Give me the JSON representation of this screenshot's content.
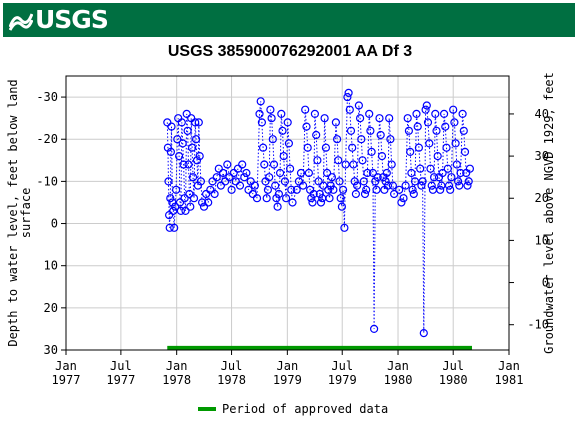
{
  "header": {
    "brand": "USGS",
    "title": "USGS 385900076292001 AA Df   3"
  },
  "colors": {
    "banner": "#006f41",
    "series": "#0000ff",
    "approved": "#009900"
  },
  "chart_data": {
    "type": "scatter",
    "title": "USGS 385900076292001 AA Df   3",
    "y_left_label": [
      "Depth to water level, feet below land",
      "surface"
    ],
    "y_right_label": "Groundwater level above NGVD 1929, feet",
    "y_left_reversed": true,
    "y_left_range": [
      -35,
      30
    ],
    "y_left_ticks": [
      {
        "value": -30,
        "label": "-30"
      },
      {
        "value": -20,
        "label": "-20"
      },
      {
        "value": -10,
        "label": "-10"
      },
      {
        "value": 0,
        "label": "0"
      },
      {
        "value": 10,
        "label": "10"
      },
      {
        "value": 20,
        "label": "20"
      },
      {
        "value": 30,
        "label": "30"
      }
    ],
    "y_right_ticks": [
      {
        "value": 40,
        "label": "40"
      },
      {
        "value": 30,
        "label": "30"
      },
      {
        "value": 20,
        "label": "20"
      },
      {
        "value": 10,
        "label": "10"
      },
      {
        "value": 0,
        "label": "0"
      },
      {
        "value": -10,
        "label": "-10"
      }
    ],
    "y_right_offset": 14,
    "x_range": [
      "1977-01-01",
      "1981-01-01"
    ],
    "x_ticks": [
      {
        "date": "1977-01-01",
        "month": "Jan",
        "year": "1977"
      },
      {
        "date": "1977-07-01",
        "month": "Jul",
        "year": "1977"
      },
      {
        "date": "1978-01-01",
        "month": "Jan",
        "year": "1978"
      },
      {
        "date": "1978-07-01",
        "month": "Jul",
        "year": "1978"
      },
      {
        "date": "1979-01-01",
        "month": "Jan",
        "year": "1979"
      },
      {
        "date": "1979-07-01",
        "month": "Jul",
        "year": "1979"
      },
      {
        "date": "1980-01-01",
        "month": "Jan",
        "year": "1980"
      },
      {
        "date": "1980-07-01",
        "month": "Jul",
        "year": "1980"
      },
      {
        "date": "1981-01-01",
        "month": "Jan",
        "year": "1981"
      }
    ],
    "grid": true,
    "legend": {
      "position": "bottom",
      "label": "Period of approved data"
    },
    "approved_period": {
      "start": "1977-12-01",
      "end": "1980-09-01",
      "y": 29.5
    },
    "series": [
      {
        "style": "circle-markers-dotted-line",
        "points": [
          [
            "1977-12-01",
            -24
          ],
          [
            "1977-12-03",
            -18
          ],
          [
            "1977-12-05",
            -10
          ],
          [
            "1977-12-07",
            -2
          ],
          [
            "1977-12-09",
            1
          ],
          [
            "1977-12-11",
            -6
          ],
          [
            "1977-12-13",
            -17
          ],
          [
            "1977-12-15",
            -23
          ],
          [
            "1977-12-18",
            -5
          ],
          [
            "1977-12-21",
            -3
          ],
          [
            "1977-12-24",
            1
          ],
          [
            "1977-12-27",
            -4
          ],
          [
            "1977-12-30",
            -8
          ],
          [
            "1978-01-03",
            -20
          ],
          [
            "1978-01-06",
            -25
          ],
          [
            "1978-01-09",
            -16
          ],
          [
            "1978-01-12",
            -5
          ],
          [
            "1978-01-15",
            -3
          ],
          [
            "1978-01-18",
            -24
          ],
          [
            "1978-01-21",
            -19
          ],
          [
            "1978-01-24",
            -14
          ],
          [
            "1978-01-27",
            -6
          ],
          [
            "1978-01-30",
            -3
          ],
          [
            "1978-02-03",
            -26
          ],
          [
            "1978-02-06",
            -22
          ],
          [
            "1978-02-09",
            -14
          ],
          [
            "1978-02-12",
            -7
          ],
          [
            "1978-02-15",
            -4
          ],
          [
            "1978-02-18",
            -25
          ],
          [
            "1978-02-21",
            -18
          ],
          [
            "1978-02-24",
            -11
          ],
          [
            "1978-02-27",
            -6
          ],
          [
            "1978-03-03",
            -24
          ],
          [
            "1978-03-06",
            -20
          ],
          [
            "1978-03-09",
            -15
          ],
          [
            "1978-03-12",
            -9
          ],
          [
            "1978-03-15",
            -24
          ],
          [
            "1978-03-18",
            -16
          ],
          [
            "1978-03-22",
            -10
          ],
          [
            "1978-03-26",
            -5
          ],
          [
            "1978-04-01",
            -4
          ],
          [
            "1978-04-08",
            -7
          ],
          [
            "1978-04-15",
            -5
          ],
          [
            "1978-04-22",
            -8
          ],
          [
            "1978-04-29",
            -10
          ],
          [
            "1978-05-06",
            -7
          ],
          [
            "1978-05-13",
            -11
          ],
          [
            "1978-05-20",
            -13
          ],
          [
            "1978-05-27",
            -9
          ],
          [
            "1978-06-03",
            -12
          ],
          [
            "1978-06-10",
            -10
          ],
          [
            "1978-06-17",
            -14
          ],
          [
            "1978-06-24",
            -11
          ],
          [
            "1978-07-01",
            -8
          ],
          [
            "1978-07-08",
            -12
          ],
          [
            "1978-07-15",
            -10
          ],
          [
            "1978-07-22",
            -13
          ],
          [
            "1978-07-29",
            -9
          ],
          [
            "1978-08-05",
            -14
          ],
          [
            "1978-08-12",
            -11
          ],
          [
            "1978-08-19",
            -12
          ],
          [
            "1978-08-26",
            -8
          ],
          [
            "1978-09-02",
            -10
          ],
          [
            "1978-09-09",
            -7
          ],
          [
            "1978-09-16",
            -9
          ],
          [
            "1978-09-23",
            -6
          ],
          [
            "1978-10-01",
            -26
          ],
          [
            "1978-10-05",
            -29
          ],
          [
            "1978-10-09",
            -24
          ],
          [
            "1978-10-13",
            -18
          ],
          [
            "1978-10-17",
            -14
          ],
          [
            "1978-10-21",
            -10
          ],
          [
            "1978-10-25",
            -6
          ],
          [
            "1978-10-29",
            -8
          ],
          [
            "1978-11-02",
            -11
          ],
          [
            "1978-11-06",
            -27
          ],
          [
            "1978-11-10",
            -25
          ],
          [
            "1978-11-14",
            -20
          ],
          [
            "1978-11-18",
            -14
          ],
          [
            "1978-11-22",
            -9
          ],
          [
            "1978-11-26",
            -6
          ],
          [
            "1978-11-30",
            -4
          ],
          [
            "1978-12-04",
            -7
          ],
          [
            "1978-12-08",
            -12
          ],
          [
            "1978-12-12",
            -26
          ],
          [
            "1978-12-16",
            -22
          ],
          [
            "1978-12-20",
            -16
          ],
          [
            "1978-12-24",
            -10
          ],
          [
            "1978-12-28",
            -6
          ],
          [
            "1979-01-02",
            -24
          ],
          [
            "1979-01-06",
            -19
          ],
          [
            "1979-01-10",
            -13
          ],
          [
            "1979-01-14",
            -8
          ],
          [
            "1979-01-18",
            -5
          ],
          [
            "1979-02-01",
            -8
          ],
          [
            "1979-02-08",
            -10
          ],
          [
            "1979-02-15",
            -12
          ],
          [
            "1979-02-22",
            -9
          ],
          [
            "1979-03-01",
            -27
          ],
          [
            "1979-03-05",
            -23
          ],
          [
            "1979-03-09",
            -18
          ],
          [
            "1979-03-13",
            -12
          ],
          [
            "1979-03-17",
            -8
          ],
          [
            "1979-03-21",
            -6
          ],
          [
            "1979-03-25",
            -5
          ],
          [
            "1979-03-29",
            -7
          ],
          [
            "1979-04-02",
            -26
          ],
          [
            "1979-04-06",
            -21
          ],
          [
            "1979-04-10",
            -15
          ],
          [
            "1979-04-14",
            -10
          ],
          [
            "1979-04-18",
            -7
          ],
          [
            "1979-04-22",
            -5
          ],
          [
            "1979-04-26",
            -6
          ],
          [
            "1979-04-30",
            -9
          ],
          [
            "1979-05-04",
            -25
          ],
          [
            "1979-05-08",
            -18
          ],
          [
            "1979-05-12",
            -12
          ],
          [
            "1979-05-16",
            -8
          ],
          [
            "1979-05-20",
            -6
          ],
          [
            "1979-05-24",
            -9
          ],
          [
            "1979-05-28",
            -11
          ],
          [
            "1979-06-02",
            -8
          ],
          [
            "1979-06-10",
            -24
          ],
          [
            "1979-06-14",
            -20
          ],
          [
            "1979-06-18",
            -15
          ],
          [
            "1979-06-22",
            -10
          ],
          [
            "1979-06-26",
            -6
          ],
          [
            "1979-06-30",
            -4
          ],
          [
            "1979-07-04",
            -8
          ],
          [
            "1979-07-08",
            1
          ],
          [
            "1979-07-12",
            -14
          ],
          [
            "1979-07-18",
            -30
          ],
          [
            "1979-07-22",
            -31
          ],
          [
            "1979-07-26",
            -27
          ],
          [
            "1979-07-30",
            -22
          ],
          [
            "1979-08-03",
            -18
          ],
          [
            "1979-08-07",
            -14
          ],
          [
            "1979-08-11",
            -10
          ],
          [
            "1979-08-15",
            -7
          ],
          [
            "1979-08-19",
            -9
          ],
          [
            "1979-08-25",
            -28
          ],
          [
            "1979-08-29",
            -25
          ],
          [
            "1979-09-02",
            -20
          ],
          [
            "1979-09-06",
            -15
          ],
          [
            "1979-09-10",
            -10
          ],
          [
            "1979-09-14",
            -7
          ],
          [
            "1979-09-18",
            -8
          ],
          [
            "1979-09-22",
            -12
          ],
          [
            "1979-09-28",
            -26
          ],
          [
            "1979-10-02",
            -22
          ],
          [
            "1979-10-06",
            -17
          ],
          [
            "1979-10-10",
            -12
          ],
          [
            "1979-10-14",
            25
          ],
          [
            "1979-10-18",
            -10
          ],
          [
            "1979-10-22",
            -8
          ],
          [
            "1979-10-26",
            -11
          ],
          [
            "1979-11-01",
            -25
          ],
          [
            "1979-11-05",
            -21
          ],
          [
            "1979-11-09",
            -16
          ],
          [
            "1979-11-13",
            -11
          ],
          [
            "1979-11-17",
            -8
          ],
          [
            "1979-11-21",
            -10
          ],
          [
            "1979-11-25",
            -12
          ],
          [
            "1979-11-29",
            -9
          ],
          [
            "1979-12-03",
            -25
          ],
          [
            "1979-12-07",
            -20
          ],
          [
            "1979-12-11",
            -14
          ],
          [
            "1979-12-15",
            -9
          ],
          [
            "1979-12-19",
            -7
          ],
          [
            "1980-01-05",
            -8
          ],
          [
            "1980-01-12",
            -5
          ],
          [
            "1980-01-19",
            -6
          ],
          [
            "1980-01-26",
            -9
          ],
          [
            "1980-02-02",
            -25
          ],
          [
            "1980-02-06",
            -22
          ],
          [
            "1980-02-10",
            -17
          ],
          [
            "1980-02-14",
            -12
          ],
          [
            "1980-02-18",
            -8
          ],
          [
            "1980-02-22",
            -7
          ],
          [
            "1980-02-26",
            -10
          ],
          [
            "1980-03-02",
            -26
          ],
          [
            "1980-03-06",
            -23
          ],
          [
            "1980-03-10",
            -18
          ],
          [
            "1980-03-14",
            -13
          ],
          [
            "1980-03-18",
            -9
          ],
          [
            "1980-03-22",
            -10
          ],
          [
            "1980-03-26",
            26
          ],
          [
            "1980-04-01",
            -27
          ],
          [
            "1980-04-05",
            -28
          ],
          [
            "1980-04-09",
            -24
          ],
          [
            "1980-04-13",
            -19
          ],
          [
            "1980-04-17",
            -13
          ],
          [
            "1980-04-21",
            -9
          ],
          [
            "1980-04-25",
            -8
          ],
          [
            "1980-04-29",
            -11
          ],
          [
            "1980-05-03",
            -26
          ],
          [
            "1980-05-07",
            -22
          ],
          [
            "1980-05-11",
            -16
          ],
          [
            "1980-05-15",
            -11
          ],
          [
            "1980-05-19",
            -8
          ],
          [
            "1980-05-23",
            -9
          ],
          [
            "1980-05-27",
            -12
          ],
          [
            "1980-06-01",
            -26
          ],
          [
            "1980-06-05",
            -23
          ],
          [
            "1980-06-09",
            -18
          ],
          [
            "1980-06-13",
            -13
          ],
          [
            "1980-06-17",
            -9
          ],
          [
            "1980-06-21",
            -8
          ],
          [
            "1980-06-25",
            -11
          ],
          [
            "1980-07-01",
            -27
          ],
          [
            "1980-07-05",
            -24
          ],
          [
            "1980-07-09",
            -19
          ],
          [
            "1980-07-13",
            -14
          ],
          [
            "1980-07-17",
            -10
          ],
          [
            "1980-07-21",
            -9
          ],
          [
            "1980-07-25",
            -12
          ],
          [
            "1980-08-01",
            -26
          ],
          [
            "1980-08-05",
            -22
          ],
          [
            "1980-08-09",
            -17
          ],
          [
            "1980-08-13",
            -12
          ],
          [
            "1980-08-17",
            -9
          ],
          [
            "1980-08-21",
            -10
          ],
          [
            "1980-08-25",
            -13
          ]
        ]
      }
    ]
  }
}
